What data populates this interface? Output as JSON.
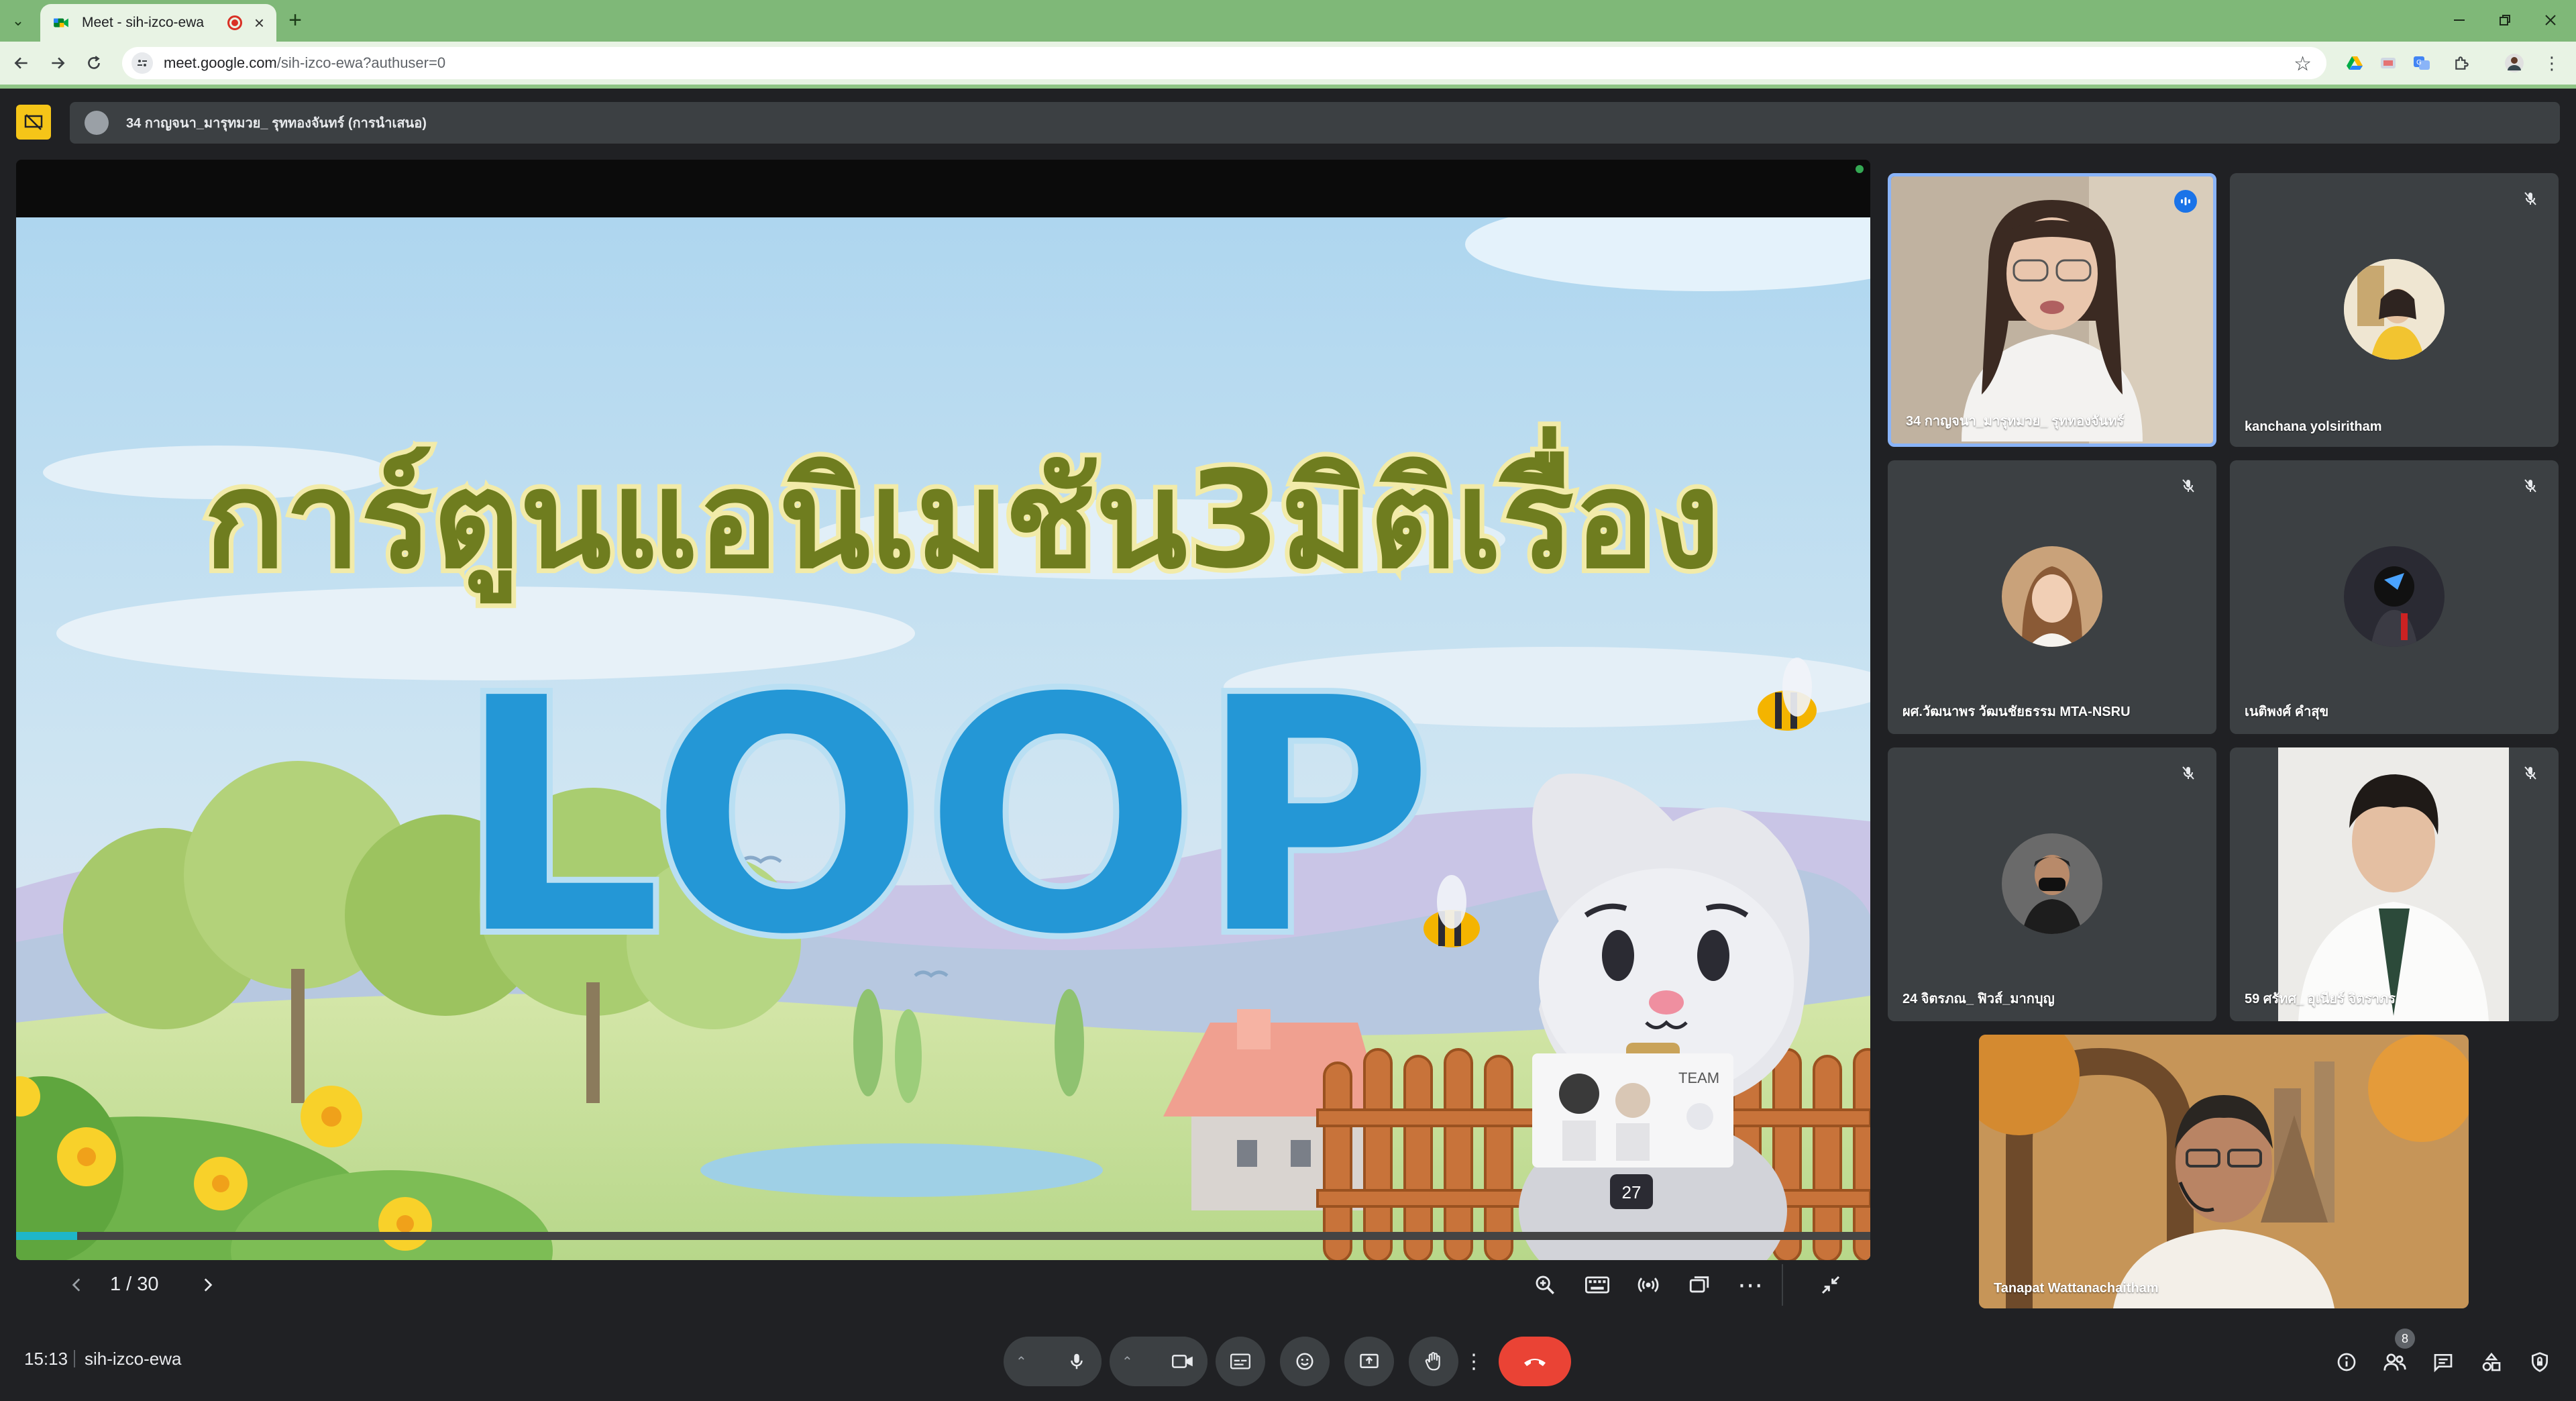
{
  "browser": {
    "tab_title": "Meet - sih-izco-ewa",
    "close_glyph": "×",
    "new_tab_glyph": "+",
    "url_host": "meet.google.com",
    "url_path": "/sih-izco-ewa?authuser=0"
  },
  "meet": {
    "presenter_bar": "34 กาญจนา_มารุทมวย_ รุททองจันทร์ (การนำเสนอ)",
    "slide": {
      "title_thai": "การ์ตูนแอนิเมชัน3มิติเรื่อง",
      "title_en": "LOOP",
      "badge_number": "27",
      "card_label": "TEAM",
      "progress": 0.033
    },
    "slide_counter": "1 / 30",
    "participants": [
      {
        "name": "34 กาญจนา_มารุทมวย_ รุททองจันทร์",
        "muted": false,
        "speaking": true
      },
      {
        "name": "kanchana yolsiritham",
        "muted": true
      },
      {
        "name": "ผศ.วัฒนาพร วัฒนชัยธรรม MTA-NSRU",
        "muted": true
      },
      {
        "name": "เนติพงศ์ คำสุข",
        "muted": true
      },
      {
        "name": "24 จิตรภณ_ ฟิวส์_มากบุญ",
        "muted": true
      },
      {
        "name": "59 ศรัทศ_ อุเนียร์ จิตราภร",
        "muted": true
      },
      {
        "name": "Tanapat Wattanachaitham",
        "muted": false
      }
    ],
    "clock": "15:13",
    "meeting_code": "sih-izco-ewa",
    "people_count": "8"
  },
  "colors": {
    "browser_accent": "#7fb878",
    "meet_bg": "#202124",
    "leave_red": "#ea4335",
    "active_border": "#8ab4f8"
  }
}
